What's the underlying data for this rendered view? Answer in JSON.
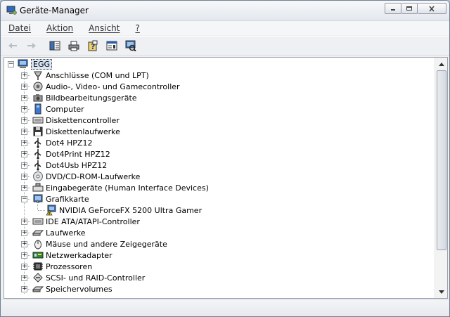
{
  "window": {
    "title": "Geräte-Manager"
  },
  "menu": {
    "items": [
      "Datei",
      "Aktion",
      "Ansicht",
      "?"
    ]
  },
  "tree": {
    "root": "EGG",
    "items": [
      {
        "label": "Anschlüsse (COM und LPT)",
        "icon": "port-icon",
        "expanded": false
      },
      {
        "label": "Audio-, Video- und Gamecontroller",
        "icon": "audio-icon",
        "expanded": false
      },
      {
        "label": "Bildbearbeitungsgeräte",
        "icon": "camera-icon",
        "expanded": false
      },
      {
        "label": "Computer",
        "icon": "computer-icon",
        "expanded": false
      },
      {
        "label": "Diskettencontroller",
        "icon": "controller-icon",
        "expanded": false
      },
      {
        "label": "Diskettenlaufwerke",
        "icon": "floppy-icon",
        "expanded": false
      },
      {
        "label": "Dot4 HPZ12",
        "icon": "usb-icon",
        "expanded": false
      },
      {
        "label": "Dot4Print HPZ12",
        "icon": "usb-icon",
        "expanded": false
      },
      {
        "label": "Dot4Usb HPZ12",
        "icon": "usb-icon",
        "expanded": false
      },
      {
        "label": "DVD/CD-ROM-Laufwerke",
        "icon": "dvd-icon",
        "expanded": false
      },
      {
        "label": "Eingabegeräte (Human Interface Devices)",
        "icon": "hid-icon",
        "expanded": false
      },
      {
        "label": "Grafikkarte",
        "icon": "display-icon",
        "expanded": true
      },
      {
        "label": "NVIDIA GeForceFX 5200 Ultra Gamer",
        "icon": "warning-display-icon",
        "child": true
      },
      {
        "label": "IDE ATA/ATAPI-Controller",
        "icon": "controller-icon",
        "expanded": false
      },
      {
        "label": "Laufwerke",
        "icon": "drive-icon",
        "expanded": false
      },
      {
        "label": "Mäuse und andere Zeigegeräte",
        "icon": "mouse-icon",
        "expanded": false
      },
      {
        "label": "Netzwerkadapter",
        "icon": "network-icon",
        "expanded": false
      },
      {
        "label": "Prozessoren",
        "icon": "cpu-icon",
        "expanded": false
      },
      {
        "label": "SCSI- und RAID-Controller",
        "icon": "scsi-icon",
        "expanded": false
      },
      {
        "label": "Speichervolumes",
        "icon": "volume-icon",
        "expanded": false
      }
    ]
  },
  "colors": {
    "selection": "#d9e6f5",
    "warning": "#f5d300",
    "accent": "#1c5fb8"
  }
}
